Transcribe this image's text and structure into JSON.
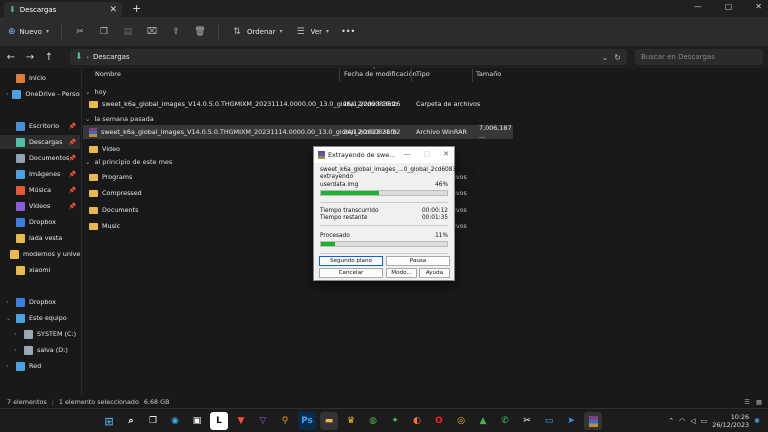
{
  "window": {
    "tab_title": "Descargas",
    "tab_close": "✕",
    "tab_add": "+"
  },
  "toolbar": {
    "new_label": "Nuevo",
    "sort_label": "Ordenar",
    "view_label": "Ver",
    "more": "•••"
  },
  "address": {
    "path": "Descargas",
    "search_placeholder": "Buscar en Descargas"
  },
  "sidebar": {
    "items": [
      {
        "label": "Inicio",
        "icon": "home-icon",
        "color": "#e07b39"
      },
      {
        "label": "OneDrive - Persona",
        "icon": "cloud-icon",
        "color": "#4aa3df"
      },
      {
        "label": "Escritorio",
        "icon": "desktop-icon",
        "color": "#4a90d9"
      },
      {
        "label": "Descargas",
        "icon": "download-icon",
        "color": "#4cc2a3"
      },
      {
        "label": "Documentos",
        "icon": "document-icon",
        "color": "#8fa3b8"
      },
      {
        "label": "Imágenes",
        "icon": "image-icon",
        "color": "#4aa3df"
      },
      {
        "label": "Música",
        "icon": "music-icon",
        "color": "#e05a3a"
      },
      {
        "label": "Videos",
        "icon": "video-icon",
        "color": "#8e5cd9"
      },
      {
        "label": "Dropbox",
        "icon": "dropbox-icon",
        "color": "#3d7de0"
      },
      {
        "label": "lada vesta",
        "icon": "folder-icon",
        "color": "#e9b949"
      },
      {
        "label": "modernos y univers",
        "icon": "folder-icon",
        "color": "#e9b949"
      },
      {
        "label": "xiaomi",
        "icon": "folder-icon",
        "color": "#e9b949"
      },
      {
        "label": "Dropbox",
        "icon": "dropbox-icon",
        "color": "#3d7de0"
      },
      {
        "label": "Este equipo",
        "icon": "computer-icon",
        "color": "#4aa3df"
      },
      {
        "label": "SYSTEM (C:)",
        "icon": "drive-icon",
        "color": "#9aa7b4"
      },
      {
        "label": "salva (D:)",
        "icon": "drive-icon",
        "color": "#9aa7b4"
      },
      {
        "label": "Red",
        "icon": "network-icon",
        "color": "#4aa3df"
      }
    ]
  },
  "columns": {
    "name": "Nombre",
    "date": "Fecha de modificación",
    "type": "Tipo",
    "size": "Tamaño"
  },
  "groups": {
    "today": "hoy",
    "last_week": "la semana pasada",
    "earlier_month": "al principio de este mes"
  },
  "files": [
    {
      "name": "sweet_k6a_global_images_V14.0.5.0.THGMIXM_20231114.0000.00_13.0_global_2cd60836fb",
      "date": "26/12/2023 10:26",
      "type": "Carpeta de archivos",
      "size": ""
    },
    {
      "name": "sweet_k6a_global_images_V14.0.5.0.THGMIXM_20231114.0000.00_13.0_global_2cd60836fb",
      "date": "24/12/2023 21:32",
      "type": "Archivo WinRAR",
      "size": "7,006,187 ..."
    },
    {
      "name": "Video"
    },
    {
      "name": "Programs"
    },
    {
      "name": "Compressed"
    },
    {
      "name": "Documents"
    },
    {
      "name": "Music"
    }
  ],
  "truncated_type": "hivos",
  "statusbar": {
    "count": "7 elementos",
    "selected": "1 elemento seleccionado",
    "size": "6.68 GB"
  },
  "clock": {
    "time": "10:26",
    "date": "26/12/2023"
  },
  "dialog": {
    "title": "Extrayendo de swe...",
    "archive": "sweet_k6a_global_images_...0_global_2cd60836fb.tgz",
    "action": "extrayendo",
    "current_file": "userdata.img",
    "file_percent": "46%",
    "file_progress": 0.46,
    "elapsed_label": "Tiempo transcurrido",
    "elapsed": "00:00:12",
    "remaining_label": "Tiempo restante",
    "remaining": "00:01:35",
    "processed_label": "Procesado",
    "processed_percent": "11%",
    "processed_progress": 0.11,
    "btn_background": "Segundo plano",
    "btn_pause": "Pausa",
    "btn_cancel": "Cancelar",
    "btn_mode": "Modo...",
    "btn_help": "Ayuda"
  }
}
